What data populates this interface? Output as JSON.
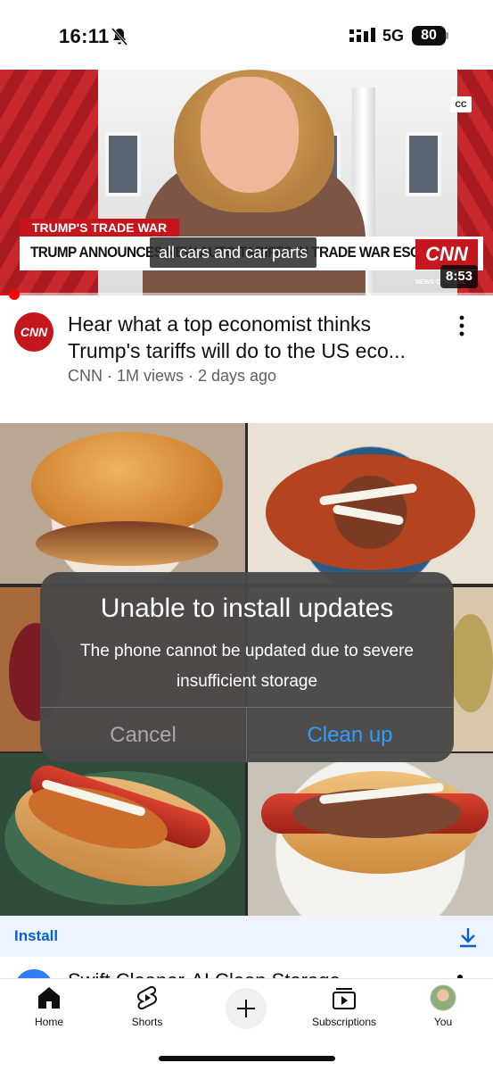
{
  "status_bar": {
    "time": "16:11",
    "network": "5G",
    "battery": "80"
  },
  "video": {
    "banner_tag": "TRUMP'S TRADE WAR",
    "banner_headline": "TRUMP ANNOUNCES NEW AUTO TARIFFS IN TRADE WAR ESCALATION",
    "cnn_logo": "CNN",
    "caption": "all cars and car parts",
    "cc_badge": "CC",
    "duration": "8:53",
    "news_tag": "NEWS CENTRAL",
    "watched_fraction": 0.03,
    "channel_avatar": "CNN",
    "title": "Hear what a top economist thinks Trump's tariffs will do to the US eco...",
    "meta": "CNN · 1M views · 2 days ago"
  },
  "alert": {
    "title": "Unable to install updates",
    "message": "The phone cannot be updated due to severe insufficient storage",
    "cancel_label": "Cancel",
    "confirm_label": "Clean up"
  },
  "install_bar": {
    "label": "Install"
  },
  "next_item": {
    "title": "Swift Cleaner-AI Clean Storage"
  },
  "nav": {
    "home": "Home",
    "shorts": "Shorts",
    "subscriptions": "Subscriptions",
    "you": "You"
  },
  "colors": {
    "youtube_red": "#ff0000",
    "cnn_red": "#c4161c",
    "link_blue": "#065fd4",
    "alert_confirm_blue": "#2f9bff"
  }
}
